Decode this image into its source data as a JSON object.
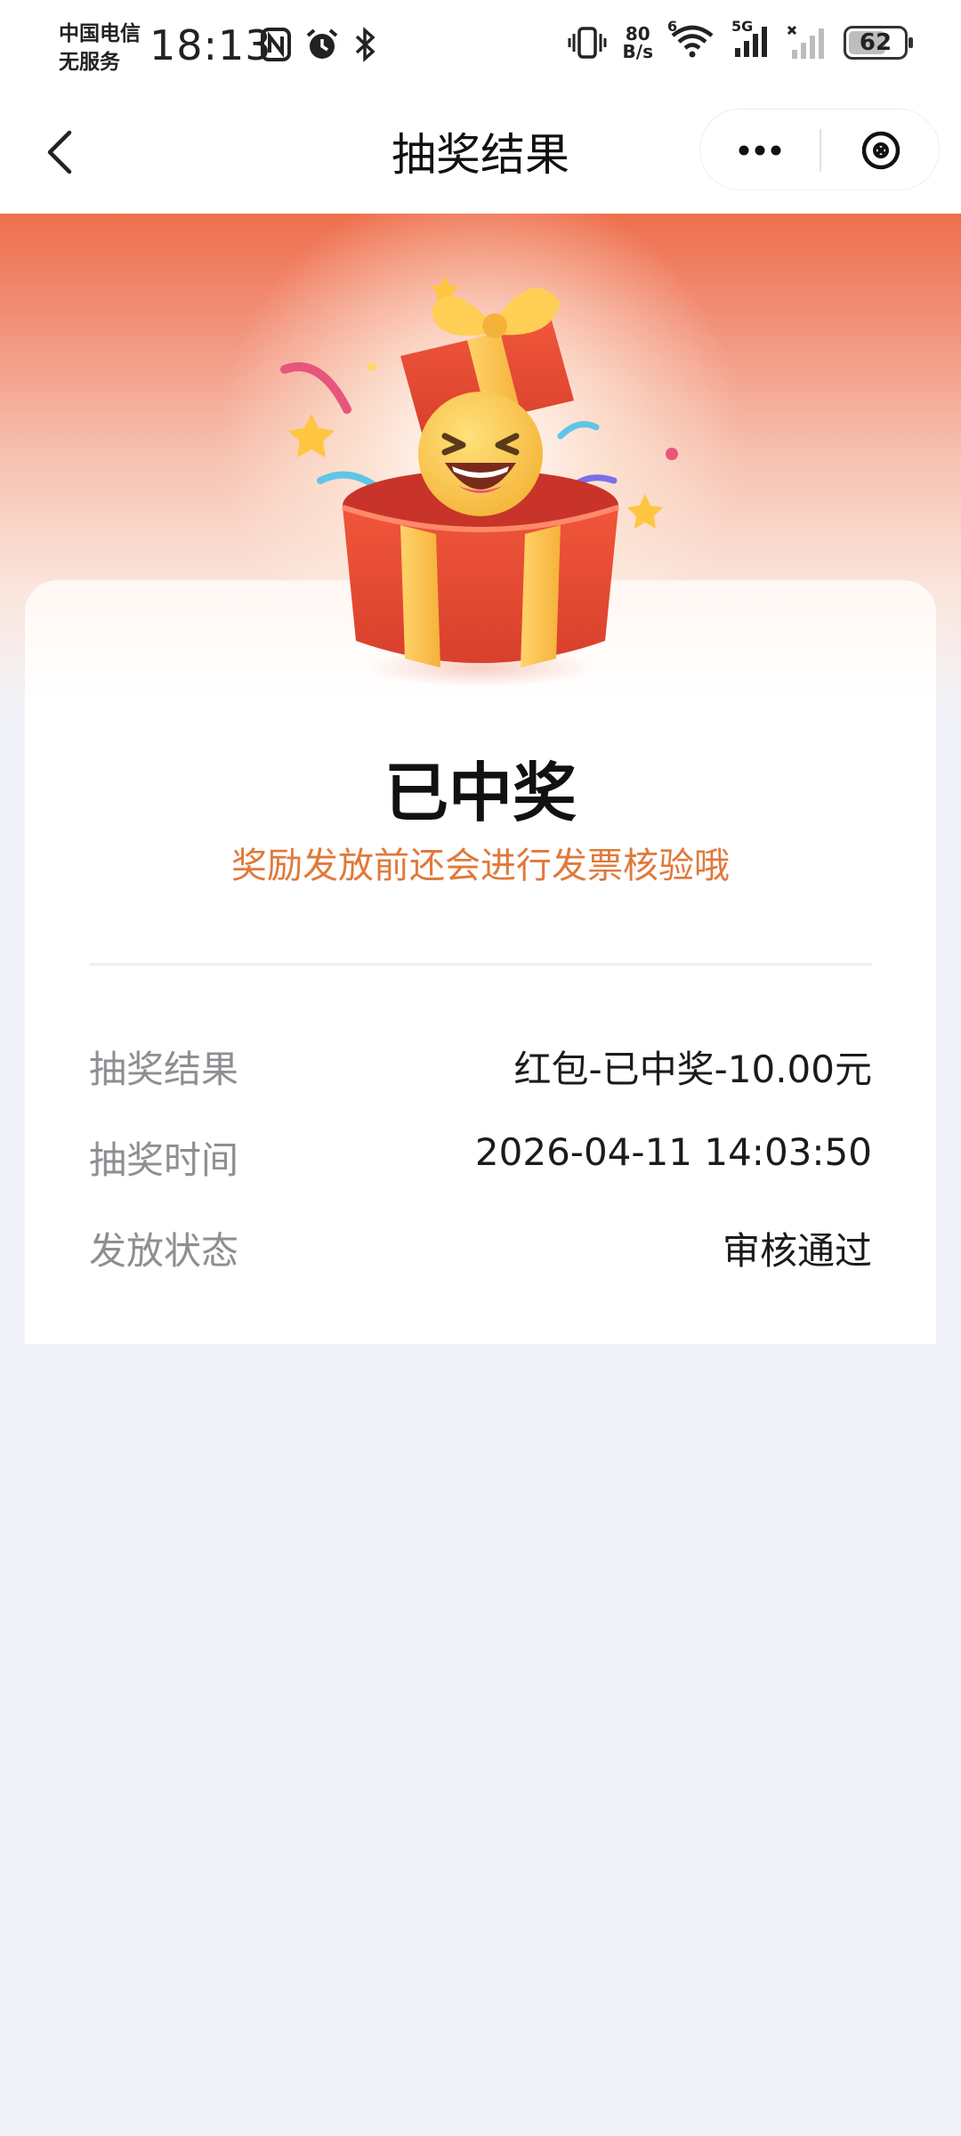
{
  "status_bar": {
    "carrier_line1": "中国电信",
    "carrier_line2": "无服务",
    "time": "18:13",
    "net_speed_value": "80",
    "net_speed_unit": "B/s",
    "wifi_badge": "6",
    "cell_badge": "5G",
    "battery": "62",
    "icons": [
      "nfc-icon",
      "alarm-icon",
      "bluetooth-icon",
      "vibrate-icon",
      "wifi-icon",
      "signal-icon",
      "no-signal-icon",
      "battery-icon"
    ]
  },
  "navbar": {
    "title": "抽奖结果",
    "back_icon": "chevron-left-icon",
    "more_icon": "more-dots-icon",
    "close_icon": "close-circle-icon"
  },
  "result": {
    "status_title": "已中奖",
    "status_subtitle": "奖励发放前还会进行发票核验哦",
    "details": [
      {
        "label": "抽奖结果",
        "value": "红包-已中奖-10.00元"
      },
      {
        "label": "抽奖时间",
        "value": "2026-04-11 14:03:50"
      },
      {
        "label": "发放状态",
        "value": "审核通过"
      }
    ]
  },
  "colors": {
    "header_orange": "#ee6f4c",
    "subtitle_orange": "#e0793a",
    "page_bg": "#f2f3f8",
    "label_gray": "#8e8e93"
  },
  "illustration": "gift-box-smiley-illustration"
}
